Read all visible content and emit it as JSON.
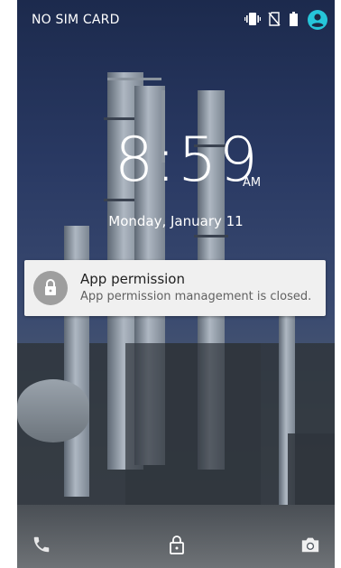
{
  "status_bar": {
    "carrier": "NO SIM CARD",
    "icons": [
      "vibrate-icon",
      "no-sim-icon",
      "battery-icon",
      "account-icon"
    ],
    "account_color": "#26c6da"
  },
  "lockscreen": {
    "time": "8:59",
    "ampm": "AM",
    "date": "Monday, January 11"
  },
  "notification": {
    "title": "App permission",
    "text": "App permission management is closed.",
    "icon": "lock-icon"
  },
  "bottom_bar": {
    "left": "phone-icon",
    "center": "lock-icon",
    "right": "camera-icon"
  }
}
